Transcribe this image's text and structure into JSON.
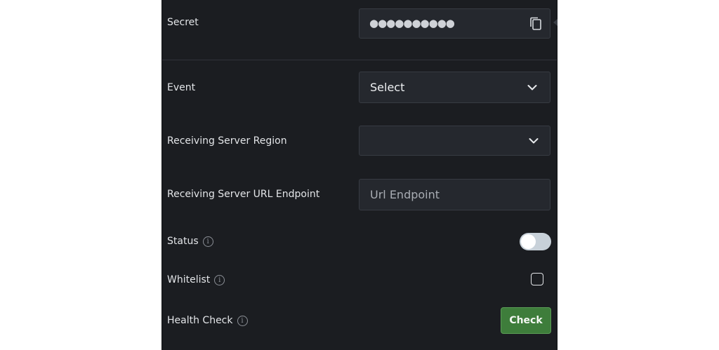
{
  "form": {
    "secret": {
      "label": "Secret",
      "masked_value": "●●●●●●●●●●",
      "copy_icon": "copy-icon"
    },
    "event": {
      "label": "Event",
      "selected": "Select",
      "icon": "chevron-down-icon"
    },
    "region": {
      "label": "Receiving Server Region",
      "selected": "",
      "icon": "chevron-down-icon"
    },
    "url": {
      "label": "Receiving Server URL Endpoint",
      "placeholder": "Url Endpoint",
      "value": ""
    },
    "status": {
      "label": "Status",
      "info_icon": "info-icon",
      "enabled": false
    },
    "whitelist": {
      "label": "Whitelist",
      "info_icon": "info-icon",
      "checked": false
    },
    "health_check": {
      "label": "Health Check",
      "info_icon": "info-icon",
      "button_label": "Check"
    }
  },
  "colors": {
    "panel_bg": "#1b1d21",
    "field_bg": "#25282e",
    "check_button_bg": "#3e7d3b",
    "toggle_off_bg": "#c8d1d9"
  },
  "info_glyph": "i"
}
